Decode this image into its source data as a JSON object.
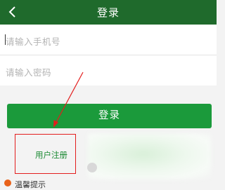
{
  "header": {
    "title": "登录",
    "back_icon": "chevron-left-icon",
    "background": "#1f6a2c"
  },
  "form": {
    "phone_placeholder": "请输入手机号",
    "password_placeholder": "请输入密码"
  },
  "login_button": {
    "label": "登录",
    "color": "#1b9a3b"
  },
  "register_link": {
    "label": "用户注册",
    "color": "#1c8a33"
  },
  "tips": {
    "label": "温馨提示",
    "icon": "info-icon"
  },
  "annotation": {
    "arrow_color": "#e31d1d",
    "box_color": "#e31d1d"
  }
}
